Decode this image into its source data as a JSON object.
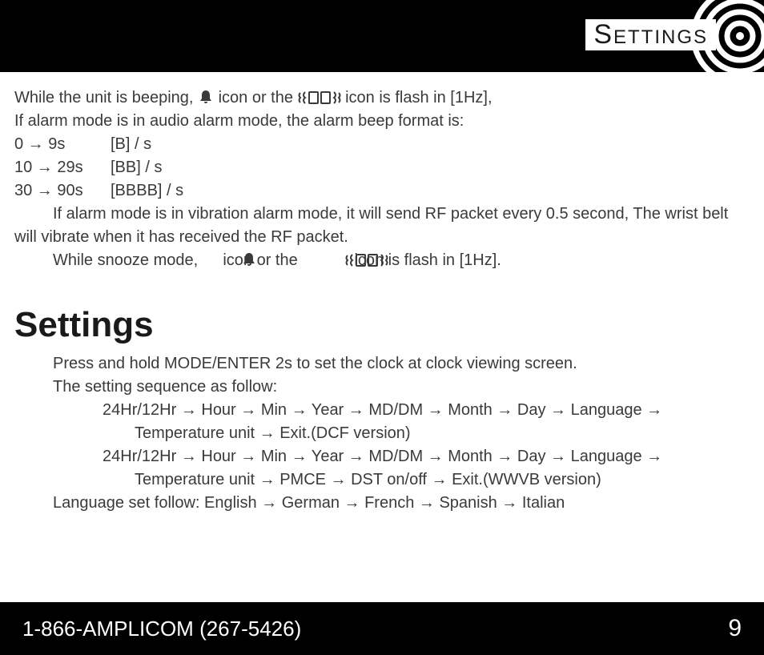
{
  "header": {
    "title": "Settings"
  },
  "body": {
    "line1a": "While the unit is beeping,",
    "line1b": "icon or the",
    "line1c": "icon is flash in [1Hz],",
    "line2": "If alarm mode is in audio alarm mode, the alarm beep format is:",
    "beep": [
      {
        "range": "0 → 9s",
        "pattern": "[B] / s"
      },
      {
        "range": "10 → 29s",
        "pattern": "[BB] / s"
      },
      {
        "range": "30 → 90s",
        "pattern": "[BBBB] / s"
      }
    ],
    "line3": "If alarm mode is in vibration alarm mode, it will send RF packet every 0.5 second, The wrist belt will vibrate when it has received the RF packet.",
    "line4a": "While snooze mode,",
    "line4b": "icon or the",
    "line4c": "icon is flash in [1Hz].",
    "heading": "Settings",
    "press": "Press and hold MODE/ENTER 2s to set the clock at clock viewing screen.",
    "seqIntro": "The setting sequence as follow:",
    "seq1a": "24Hr/12Hr → Hour → Min → Year → MD/DM → Month → Day → Language →",
    "seq1b": "Temperature unit → Exit.(DCF version)",
    "seq2a": "24Hr/12Hr → Hour → Min → Year → MD/DM → Month → Day → Language →",
    "seq2b": "Temperature unit → PMCE → DST on/off → Exit.(WWVB version)",
    "lang": "Language set follow: English → German → French → Spanish → Italian"
  },
  "footer": {
    "phone": "1-866-AMPLICOM (267-5426)",
    "page": "9"
  }
}
